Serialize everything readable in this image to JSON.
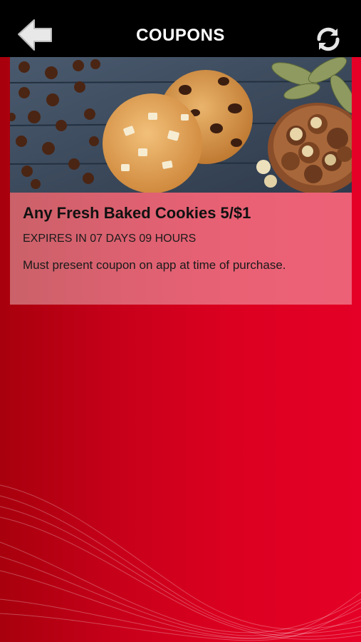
{
  "header": {
    "title": "COUPONS",
    "back_icon": "back-arrow-icon",
    "refresh_icon": "refresh-icon"
  },
  "coupon": {
    "title": "Any Fresh Baked Cookies 5/$1",
    "expiry": "EXPIRES IN 07 DAYS 09 HOURS",
    "note": "Must present coupon on app at time of purchase."
  },
  "colors": {
    "header_bg": "#000000",
    "background_red": "#dc0020",
    "background_dark_red": "#a8000d"
  }
}
